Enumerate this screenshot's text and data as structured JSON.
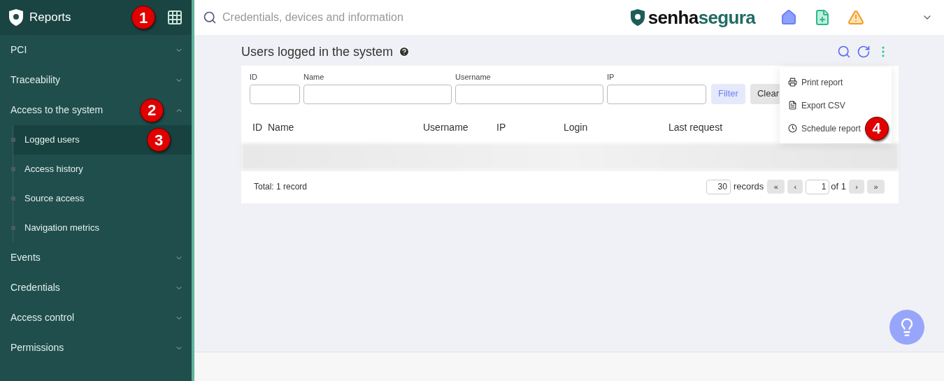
{
  "header": {
    "title": "Reports",
    "badge": "1"
  },
  "sidebar": {
    "items": [
      {
        "label": "PCI",
        "expanded": false
      },
      {
        "label": "Traceability",
        "expanded": false
      },
      {
        "label": "Access to the system",
        "expanded": true,
        "badge": "2",
        "children": [
          {
            "label": "Logged users",
            "selected": true,
            "badge": "3"
          },
          {
            "label": "Access history",
            "selected": false
          },
          {
            "label": "Source access",
            "selected": false
          },
          {
            "label": "Navigation metrics",
            "selected": false
          }
        ]
      },
      {
        "label": "Events",
        "expanded": false
      },
      {
        "label": "Credentials",
        "expanded": false
      },
      {
        "label": "Access control",
        "expanded": false
      },
      {
        "label": "Permissions",
        "expanded": false
      }
    ]
  },
  "search": {
    "placeholder": "Credentials, devices and information"
  },
  "brand": {
    "first": "senha",
    "second": "segura"
  },
  "page": {
    "title": "Users logged in the system"
  },
  "filters": [
    {
      "label": "ID"
    },
    {
      "label": "Name"
    },
    {
      "label": "Username"
    },
    {
      "label": "IP"
    }
  ],
  "filter_buttons": [
    {
      "label": "Filter",
      "kind": "primary"
    },
    {
      "label": "Clear",
      "kind": "secondary"
    }
  ],
  "table": {
    "columns": [
      "ID",
      "Name",
      "Username",
      "IP",
      "Login",
      "Last request"
    ]
  },
  "menu": {
    "items": [
      {
        "label": "Print report",
        "kind": "print"
      },
      {
        "label": "Export CSV",
        "kind": "file"
      },
      {
        "label": "Schedule report",
        "kind": "clock",
        "badge": "4"
      }
    ]
  },
  "footer": {
    "total": "Total: 1 record",
    "page_size": "30",
    "records_label": "records",
    "first": "«",
    "prev": "‹",
    "page": "1",
    "of": "of 1",
    "next": "›",
    "last": "»"
  }
}
